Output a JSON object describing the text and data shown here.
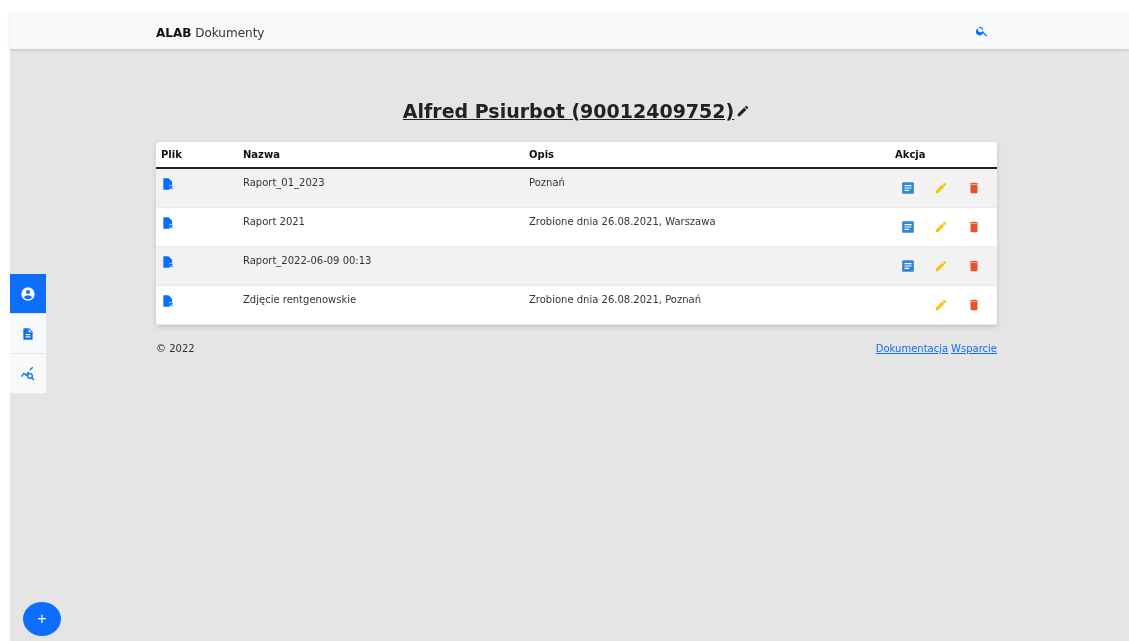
{
  "navbar": {
    "brand_bold": "ALAB",
    "brand": "Dokumenty"
  },
  "side_nav": [
    {
      "kind": "user",
      "selected": true
    },
    {
      "kind": "document",
      "selected": false
    },
    {
      "kind": "analysis",
      "selected": false
    }
  ],
  "title": "Alfred Psiurbot (90012409752)",
  "table": {
    "columns": [
      "Plik",
      "Nazwa",
      "Opis",
      "Akcja"
    ],
    "rows": [
      {
        "name": "Raport_01_2023",
        "description": "Poznań",
        "has_preview": true
      },
      {
        "name": "Raport 2021",
        "description": "Zrobione dnia 26.08.2021, Warszawa",
        "has_preview": true
      },
      {
        "name": "Raport_2022-06-09 00:13",
        "description": "",
        "has_preview": true
      },
      {
        "name": "Zdjęcie rentgenowskie",
        "description": "Zrobione dnia 26.08.2021, Poznań",
        "has_preview": false
      }
    ]
  },
  "footer": {
    "copyright": "© 2022",
    "links": [
      "Dokumentacja",
      "Wsparcie"
    ]
  },
  "fab": "+"
}
